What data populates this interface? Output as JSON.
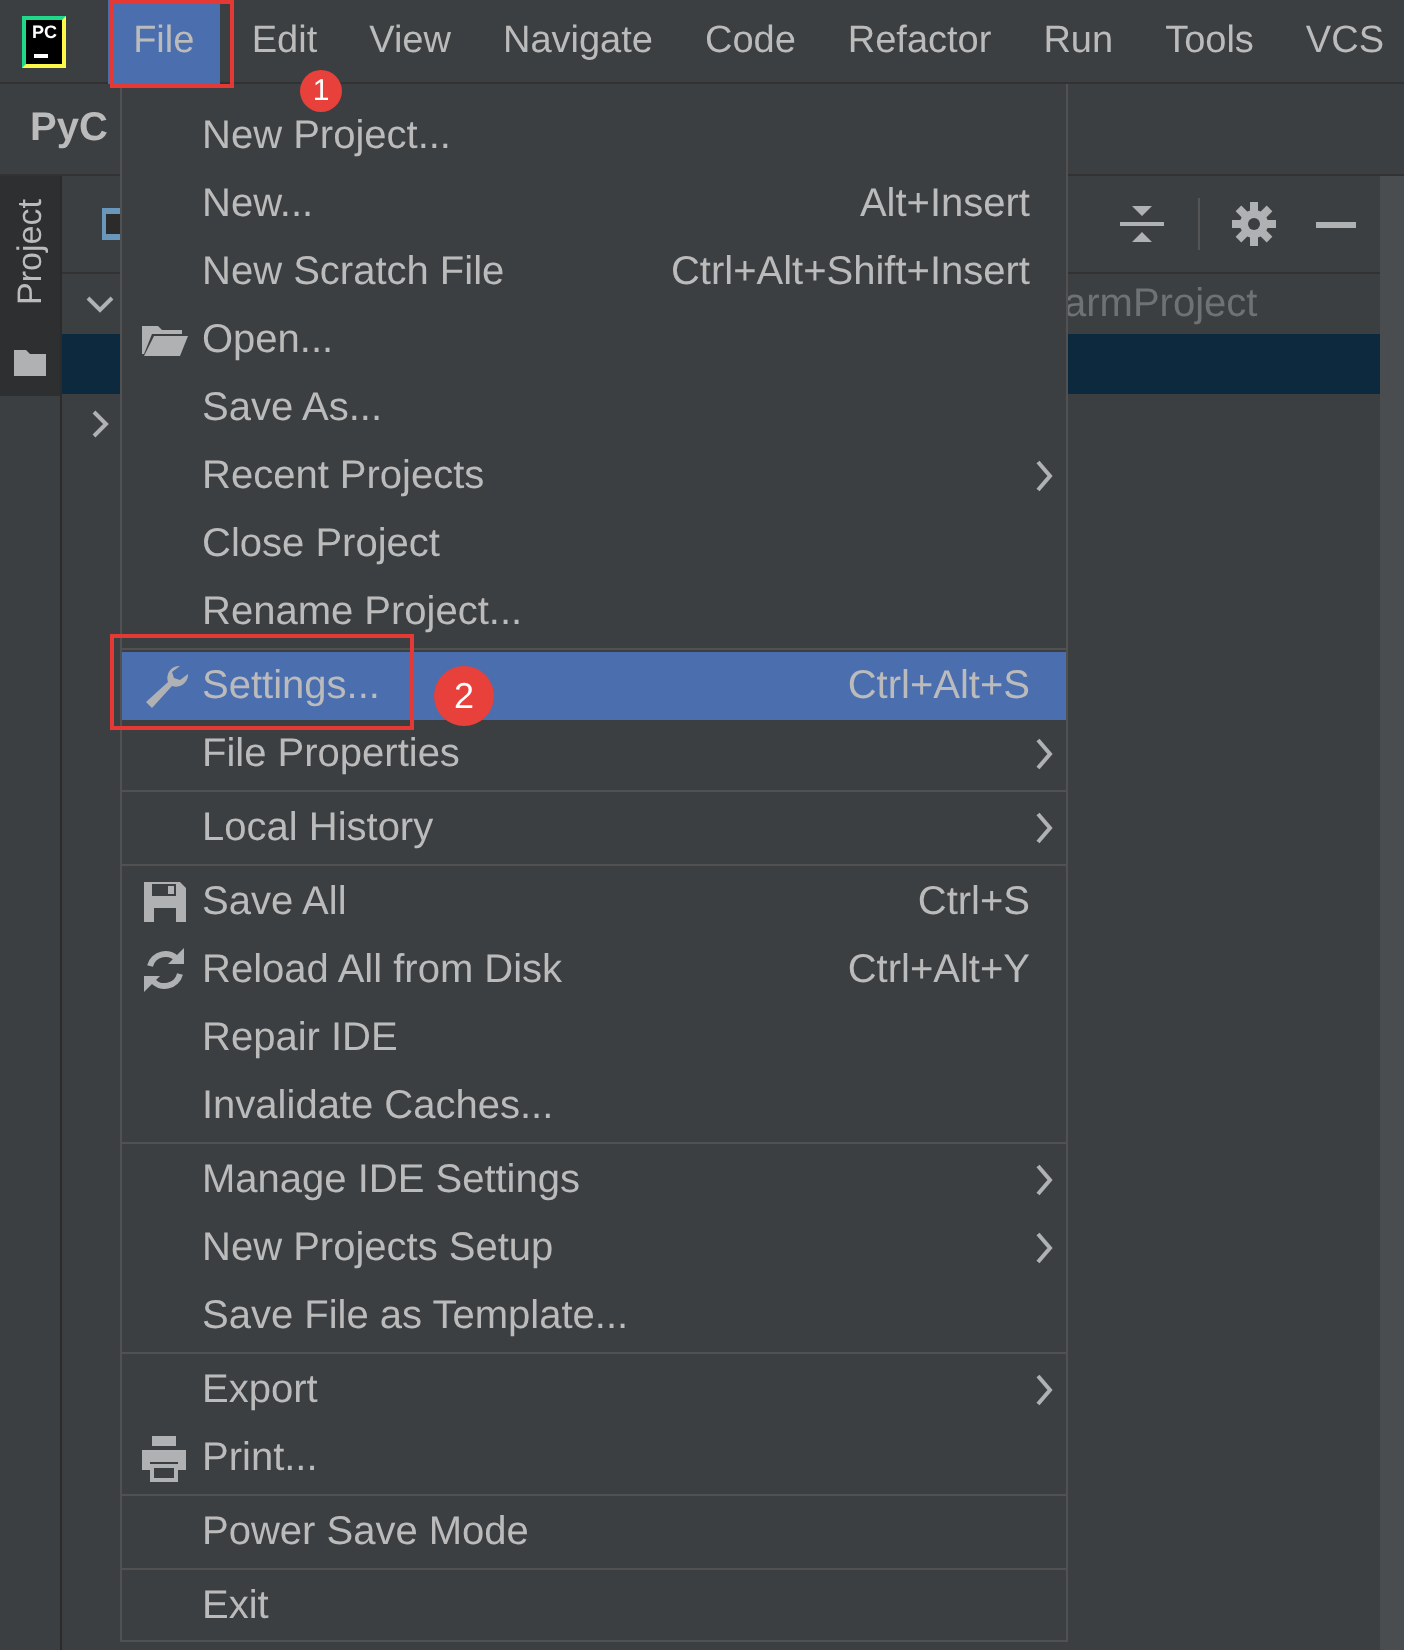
{
  "logo": {
    "text": "PC"
  },
  "menubar": [
    {
      "label": "File",
      "selected": true
    },
    {
      "label": "Edit",
      "selected": false
    },
    {
      "label": "View",
      "selected": false
    },
    {
      "label": "Navigate",
      "selected": false
    },
    {
      "label": "Code",
      "selected": false
    },
    {
      "label": "Refactor",
      "selected": false
    },
    {
      "label": "Run",
      "selected": false
    },
    {
      "label": "Tools",
      "selected": false
    },
    {
      "label": "VCS",
      "selected": false
    }
  ],
  "toolbar": {
    "title": "PyC"
  },
  "side_tab": {
    "label": "Project"
  },
  "tree": {
    "rows": [
      {
        "text": "armProject",
        "expanded": true,
        "selected": false
      },
      {
        "selected": true
      },
      {
        "expanded": false,
        "selected": false
      }
    ]
  },
  "menu": {
    "items": [
      {
        "kind": "item",
        "label": "New Project...",
        "selected": false,
        "submenu": false
      },
      {
        "kind": "item",
        "label": "New...",
        "shortcut": "Alt+Insert",
        "selected": false,
        "submenu": false
      },
      {
        "kind": "item",
        "label": "New Scratch File",
        "shortcut": "Ctrl+Alt+Shift+Insert",
        "selected": false,
        "submenu": false
      },
      {
        "kind": "folder",
        "label": "Open...",
        "selected": false,
        "submenu": false
      },
      {
        "kind": "item",
        "label": "Save As...",
        "selected": false,
        "submenu": false
      },
      {
        "kind": "item",
        "label": "Recent Projects",
        "selected": false,
        "submenu": true
      },
      {
        "kind": "item",
        "label": "Close Project",
        "selected": false,
        "submenu": false
      },
      {
        "kind": "item",
        "label": "Rename Project...",
        "selected": false,
        "submenu": false
      },
      {
        "kind": "separator"
      },
      {
        "kind": "wrench",
        "label": "Settings...",
        "shortcut": "Ctrl+Alt+S",
        "selected": true,
        "submenu": false
      },
      {
        "kind": "item",
        "label": "File Properties",
        "selected": false,
        "submenu": true
      },
      {
        "kind": "separator"
      },
      {
        "kind": "item",
        "label": "Local History",
        "selected": false,
        "submenu": true
      },
      {
        "kind": "separator"
      },
      {
        "kind": "disk",
        "label": "Save All",
        "shortcut": "Ctrl+S",
        "selected": false,
        "submenu": false
      },
      {
        "kind": "reload",
        "label": "Reload All from Disk",
        "shortcut": "Ctrl+Alt+Y",
        "selected": false,
        "submenu": false
      },
      {
        "kind": "item",
        "label": "Repair IDE",
        "selected": false,
        "submenu": false
      },
      {
        "kind": "item",
        "label": "Invalidate Caches...",
        "selected": false,
        "submenu": false
      },
      {
        "kind": "separator"
      },
      {
        "kind": "item",
        "label": "Manage IDE Settings",
        "selected": false,
        "submenu": true
      },
      {
        "kind": "item",
        "label": "New Projects Setup",
        "selected": false,
        "submenu": true
      },
      {
        "kind": "item",
        "label": "Save File as Template...",
        "selected": false,
        "submenu": false
      },
      {
        "kind": "separator"
      },
      {
        "kind": "item",
        "label": "Export",
        "selected": false,
        "submenu": true
      },
      {
        "kind": "printer",
        "label": "Print...",
        "selected": false,
        "submenu": false
      },
      {
        "kind": "separator"
      },
      {
        "kind": "item",
        "label": "Power Save Mode",
        "selected": false,
        "submenu": false
      },
      {
        "kind": "separator"
      },
      {
        "kind": "item",
        "label": "Exit",
        "selected": false,
        "submenu": false
      }
    ]
  },
  "annotations": [
    {
      "label": "1"
    },
    {
      "label": "2"
    }
  ]
}
